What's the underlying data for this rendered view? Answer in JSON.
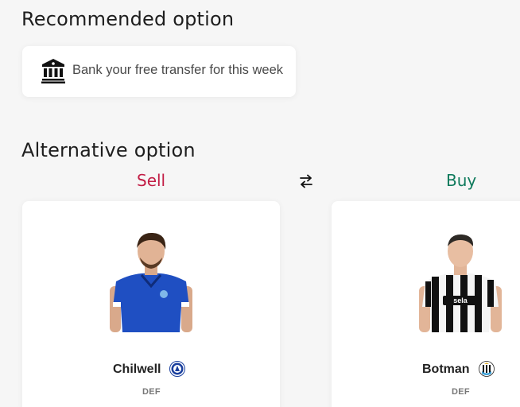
{
  "recommended": {
    "heading": "Recommended option",
    "icon": "bank-icon",
    "text": "Bank your free transfer for this week"
  },
  "alternative": {
    "heading": "Alternative option",
    "sell_label": "Sell",
    "buy_label": "Buy",
    "swap_icon": "swap-arrows-icon"
  },
  "sell_player": {
    "name": "Chilwell",
    "position": "DEF",
    "club_icon": "chelsea-badge-icon"
  },
  "buy_player": {
    "name": "Botman",
    "position": "DEF",
    "club_icon": "newcastle-badge-icon"
  },
  "colors": {
    "sell": "#c21d45",
    "buy": "#0f7a5c"
  }
}
